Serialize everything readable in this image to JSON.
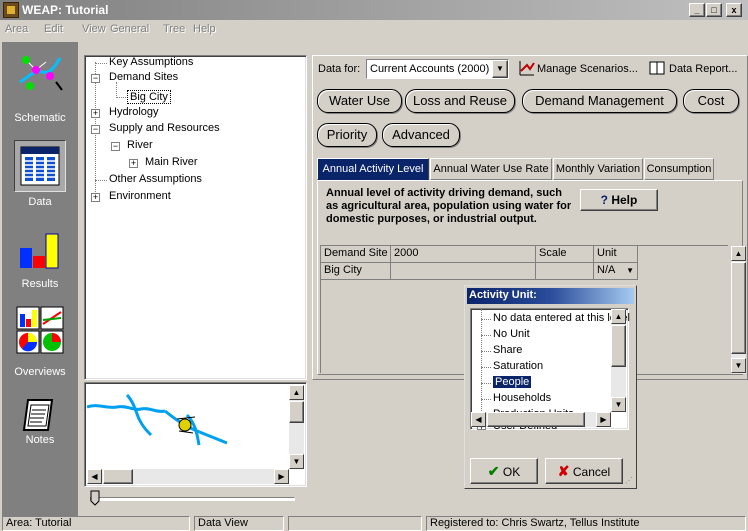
{
  "window": {
    "title": "WEAP: Tutorial"
  },
  "menu": [
    "Area",
    "Edit",
    "View",
    "General",
    "Tree",
    "Help"
  ],
  "viewbar": [
    {
      "label": "Schematic",
      "icon": "schematic-icon"
    },
    {
      "label": "Data",
      "icon": "data-icon",
      "selected": true
    },
    {
      "label": "Results",
      "icon": "results-icon"
    },
    {
      "label": "Overviews",
      "icon": "overviews-icon"
    },
    {
      "label": "Notes",
      "icon": "notes-icon"
    }
  ],
  "tree": {
    "items": [
      {
        "label": "Key Assumptions"
      },
      {
        "label": "Demand Sites",
        "expander": "−"
      },
      {
        "label": "Big City",
        "selected": true
      },
      {
        "label": "Hydrology",
        "expander": "+"
      },
      {
        "label": "Supply and Resources",
        "expander": "−"
      },
      {
        "label": "River",
        "expander": "−"
      },
      {
        "label": "Main River",
        "expander": "+"
      },
      {
        "label": "Other Assumptions"
      },
      {
        "label": "Environment",
        "expander": "+"
      }
    ]
  },
  "toolbar": {
    "data_for_label": "Data for:",
    "data_for_value": "Current Accounts (2000)",
    "manage_scenarios": "Manage Scenarios...",
    "data_report": "Data Report..."
  },
  "main_tabs": [
    "Water Use",
    "Loss and Reuse",
    "Demand Management",
    "Cost",
    "Priority",
    "Advanced"
  ],
  "sub_tabs": [
    "Annual Activity Level",
    "Annual Water Use Rate",
    "Monthly Variation",
    "Consumption"
  ],
  "description": "Annual level of activity driving demand, such as agricultural area, population using water for domestic purposes, or industrial output.",
  "help_button": "Help",
  "grid": {
    "headers": [
      "Demand Site",
      "2000",
      "Scale",
      "Unit"
    ],
    "rows": [
      {
        "site": "Big City",
        "value": "",
        "scale": "",
        "unit": "N/A"
      }
    ]
  },
  "popup": {
    "title": "Activity Unit:",
    "items": [
      "No data entered at this level",
      "No Unit",
      "Share",
      "Saturation",
      "People",
      "Households",
      "Production Units",
      "User Defined"
    ],
    "selected": "People",
    "ok": "OK",
    "cancel": "Cancel"
  },
  "status": {
    "area": "Area: Tutorial",
    "view": "Data View",
    "empty": "",
    "registered": "Registered to: Chris Swartz, Tellus Institute"
  },
  "colors": {
    "selection": "#0a246a",
    "river": "#00a0f0",
    "tab_active": "#0a246a"
  }
}
